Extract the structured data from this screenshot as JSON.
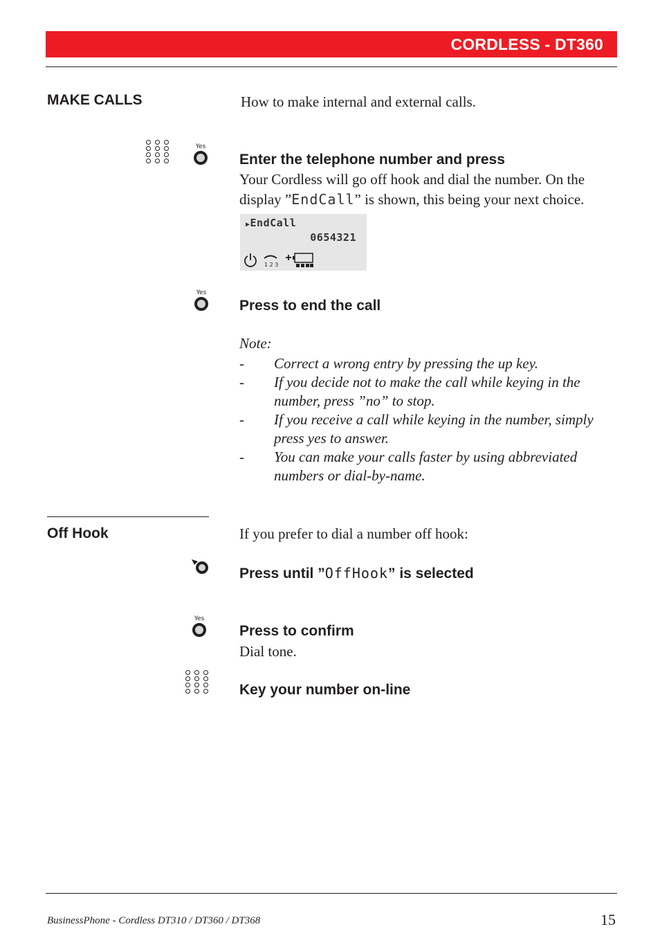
{
  "header": {
    "title": "CORDLESS - DT360",
    "accent_color": "#ed1c24"
  },
  "make_calls": {
    "title": "MAKE CALLS",
    "intro": "How to make internal and external calls.",
    "step1": {
      "icons": [
        "keypad-icon",
        "yes-key-icon"
      ],
      "yes_label": "Yes",
      "title": "Enter the telephone number and press",
      "text_line1": "Your Cordless will go off hook and dial the number. On the",
      "text_line2_prefix": "display ”",
      "text_line2_lcd": "EndCall",
      "text_line2_suffix": "” is shown, this being your next choice.",
      "display": {
        "line1": "EndCall",
        "line2": "0654321",
        "icons": [
          "power-icon",
          "handset-123-icon",
          "battery-icon"
        ],
        "keys_label": "1 2 3"
      }
    },
    "step2": {
      "yes_label": "Yes",
      "title": "Press to end the call"
    },
    "note": {
      "title": "Note:",
      "dash": "-",
      "items": [
        [
          "Correct a wrong entry by pressing the up key."
        ],
        [
          "If you decide not to make the call while keying in the",
          "number, press ”no” to stop."
        ],
        [
          "If you receive a call while keying in the number, simply",
          "press yes to answer."
        ],
        [
          "You can make your calls faster by using abbreviated",
          "numbers  or dial-by-name."
        ]
      ]
    }
  },
  "off_hook": {
    "title": "Off Hook",
    "intro": "If you prefer to dial a number off hook:",
    "step1": {
      "title_prefix": "Press until ”",
      "title_lcd": "OffHook",
      "title_suffix": "” is selected"
    },
    "step2": {
      "yes_label": "Yes",
      "title": "Press to confirm",
      "text": "Dial tone."
    },
    "step3": {
      "title": "Key your number on-line"
    }
  },
  "footer": {
    "text": "BusinessPhone - Cordless DT310 / DT360 / DT368",
    "page_number": "15"
  }
}
